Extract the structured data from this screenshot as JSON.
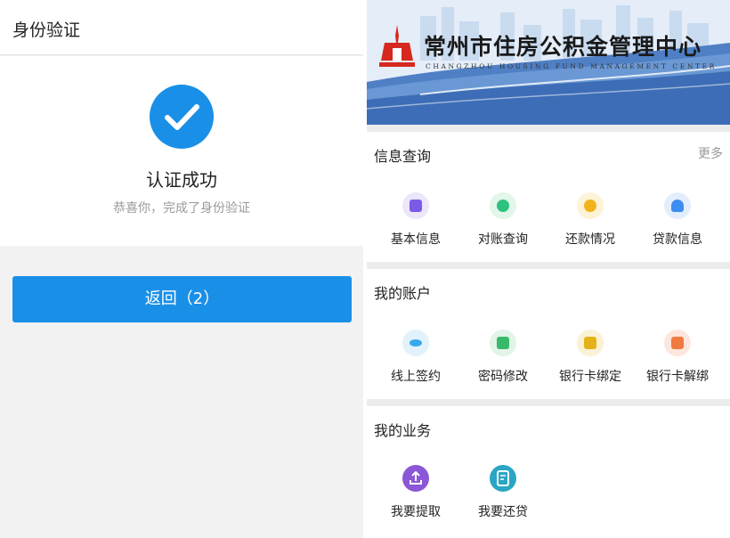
{
  "left": {
    "header_title": "身份验证",
    "success_title": "认证成功",
    "success_subtitle": "恭喜你，完成了身份验证",
    "back_button": "返回（2）",
    "accent": "#1a8fe8"
  },
  "right": {
    "banner": {
      "title": "常州市住房公积金管理中心",
      "subtitle": "CHANGZHOU HOUSING FUND MANAGEMENT CENTER"
    },
    "sections": [
      {
        "title": "信息查询",
        "more": "更多",
        "items": [
          {
            "label": "基本信息",
            "icon": "id-card-icon",
            "color": "#7b5be6"
          },
          {
            "label": "对账查询",
            "icon": "statement-icon",
            "color": "#2ec27e"
          },
          {
            "label": "还款情况",
            "icon": "coin-icon",
            "color": "#f2b21b"
          },
          {
            "label": "贷款信息",
            "icon": "loan-user-icon",
            "color": "#3d8ef0"
          }
        ]
      },
      {
        "title": "我的账户",
        "items": [
          {
            "label": "线上签约",
            "icon": "handshake-icon",
            "color": "#38a8ea"
          },
          {
            "label": "密码修改",
            "icon": "lock-icon",
            "color": "#38b96a"
          },
          {
            "label": "银行卡绑定",
            "icon": "card-bind-icon",
            "color": "#e6b21a"
          },
          {
            "label": "银行卡解绑",
            "icon": "card-unbind-icon",
            "color": "#f07b3f"
          }
        ]
      },
      {
        "title": "我的业务",
        "items": [
          {
            "label": "我要提取",
            "icon": "withdraw-icon",
            "color": "#8b57d6"
          },
          {
            "label": "我要还贷",
            "icon": "repay-icon",
            "color": "#2aa6c4"
          }
        ]
      }
    ]
  }
}
